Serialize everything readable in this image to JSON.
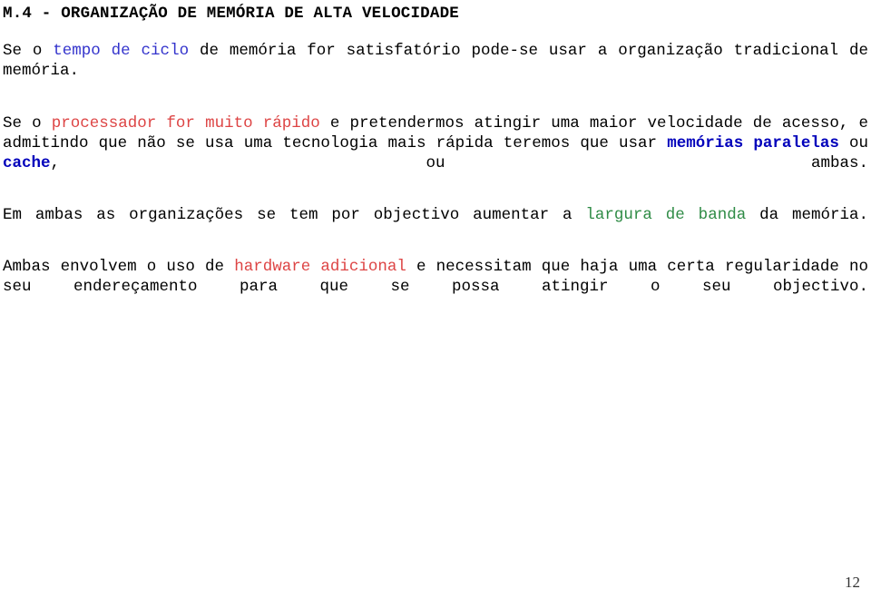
{
  "document": {
    "title": "M.4 - ORGANIZAÇÃO DE MEMÓRIA DE ALTA VELOCIDADE",
    "page_number": "12",
    "colors": {
      "text": "#000000",
      "highlight_blue": "#3333cc",
      "term_blue_bold": "#0000bb",
      "highlight_red": "#dd4444",
      "highlight_green": "#2e8b45"
    },
    "paragraphs": [
      {
        "id": "p1",
        "runs": [
          {
            "text": "Se o ",
            "style": "plain"
          },
          {
            "text": "tempo de ciclo",
            "style": "blue"
          },
          {
            "text": " de memória for satisfatório pode-se usar a organização tradicional de memória.",
            "style": "plain"
          }
        ]
      },
      {
        "id": "p2",
        "runs": [
          {
            "text": "Se o ",
            "style": "plain"
          },
          {
            "text": "processador for muito rápido",
            "style": "red"
          },
          {
            "text": " e pretendermos atingir uma maior velocidade de acesso, e admitindo que não se usa uma tecnologia mais rápida teremos que usar ",
            "style": "plain"
          },
          {
            "text": "memórias paralelas",
            "style": "blue-bold"
          },
          {
            "text": " ou ",
            "style": "plain"
          },
          {
            "text": "cache",
            "style": "blue-bold"
          },
          {
            "text": ", ou ambas.",
            "style": "plain"
          }
        ]
      },
      {
        "id": "p3",
        "runs": [
          {
            "text": "Em ambas as organizações se tem por objectivo aumentar a ",
            "style": "plain"
          },
          {
            "text": "largura de banda",
            "style": "green"
          },
          {
            "text": " da memória.",
            "style": "plain"
          }
        ]
      },
      {
        "id": "p4",
        "runs": [
          {
            "text": "Ambas envolvem o uso de ",
            "style": "plain"
          },
          {
            "text": "hardware adicional",
            "style": "red"
          },
          {
            "text": " e necessitam que haja uma certa regularidade no seu endereçamento para que se possa atingir o seu objectivo.",
            "style": "plain"
          }
        ]
      }
    ]
  }
}
